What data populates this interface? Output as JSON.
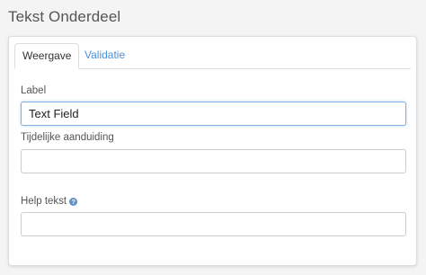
{
  "header": {
    "title": "Tekst Onderdeel"
  },
  "tabs": [
    {
      "label": "Weergave",
      "active": true
    },
    {
      "label": "Validatie",
      "active": false
    }
  ],
  "fields": {
    "label": {
      "label": "Label",
      "value": "Text Field"
    },
    "placeholder": {
      "label": "Tijdelijke aanduiding",
      "value": ""
    },
    "help": {
      "label": "Help tekst",
      "icon": "question-circle-icon",
      "value": ""
    }
  },
  "colors": {
    "accent": "#4a90d9",
    "help_icon": "#5f8fc4",
    "focus_border": "#7fb1e0"
  }
}
